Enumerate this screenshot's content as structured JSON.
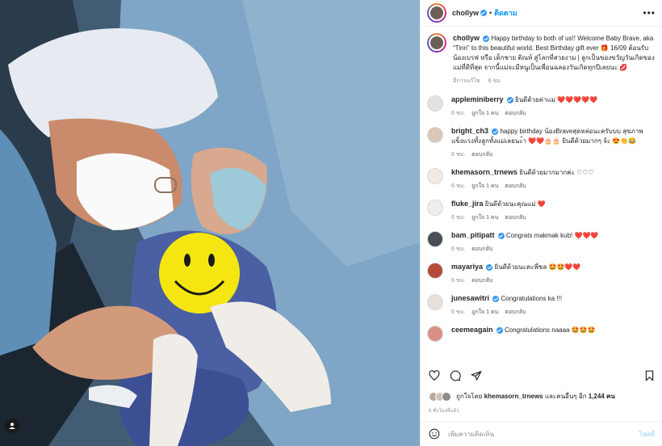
{
  "post": {
    "author": "chollyw",
    "follow_label": "ติดตาม",
    "caption": "Happy birthday to both of us!! Welcome Baby Brave, aka “Tinn” to this beautiful world. Best Birthday gift ever 🎁 16/09 ต้อนรับน้องเบรฟ หรือ เด็กชาย ติณห์ สู่โลกที่สวยงาม | ลูกเป็นของขวัญวันเกิดของแม่ที่ดีที่สุด จากนี้แม่จะมีหนูเป็นเพื่อนฉลองวันเกิดทุกปีเลยนะ 💋",
    "caption_edited": "มีการแก้ไข",
    "caption_time": "6 ชม."
  },
  "comments": [
    {
      "user": "appleminiberry",
      "text": "ยินดีด้วยค่าแม่",
      "hearts": "❤️❤️❤️❤️❤️",
      "time": "6 ชม.",
      "likes": "ถูกใจ 1 คน",
      "reply": "ตอบกลับ"
    },
    {
      "user": "bright_ch3",
      "text": "happy birthday น้องBraveสุดหล่อนะครับบบ สุขภาพแข็งแรงทั้งลูกทั้งแม่เลยนะ้า",
      "hearts": "❤️❤️🎂🎂 ยินดีด้วยมากๆ จ้ะ 😍👏😂",
      "time": "6 ชม.",
      "likes": "",
      "reply": "ตอบกลับ"
    },
    {
      "user": "khemasorn_trnews",
      "text": "ยินดีด้วยมากมากค่ะ",
      "hearts": "♡♡♡",
      "time": "6 ชม.",
      "likes": "ถูกใจ 1 คน",
      "reply": "ตอบกลับ"
    },
    {
      "user": "fluke_jira",
      "text": "ยินดีด้วยนะคุณแม่",
      "hearts": "❤️",
      "time": "6 ชม.",
      "likes": "ถูกใจ 1 คน",
      "reply": "ตอบกลับ"
    },
    {
      "user": "bam_pitipatt",
      "text": "Congrats makmak kub!",
      "hearts": "❤️❤️❤️",
      "time": "6 ชม.",
      "likes": "",
      "reply": "ตอบกลับ"
    },
    {
      "user": "mayariya",
      "text": "ยินดีด้วยนะคะพี่ชล",
      "hearts": "🤩🤩❤️❤️",
      "time": "6 ชม.",
      "likes": "",
      "reply": "ตอบกลับ"
    },
    {
      "user": "junesawitri",
      "text": "Congratulations ka !!!",
      "hearts": "",
      "time": "6 ชม.",
      "likes": "ถูกใจ 1 คน",
      "reply": "ตอบกลับ"
    },
    {
      "user": "ceemeagain",
      "text": "Congratulations naaaa",
      "hearts": "🤩🤩🤩",
      "time": "",
      "likes": "",
      "reply": ""
    }
  ],
  "likes": {
    "prefix": "ถูกใจโดย",
    "user": "khemasorn_trnews",
    "mid": "และคนอื่นๆ อีก",
    "count": "1,244 คน"
  },
  "time_ago": "6 ชั่วโมงที่แล้ว",
  "add_comment": {
    "placeholder": "เพิ่มความคิดเห็น",
    "post_label": "โพสต์"
  },
  "icons": [
    "heart-icon",
    "comment-icon",
    "share-icon",
    "bookmark-icon",
    "emoji-icon",
    "more-icon",
    "user-tag-icon"
  ],
  "colors": {
    "link": "#0095f6",
    "verified": "#3897f0",
    "heart": "#ed4956"
  }
}
